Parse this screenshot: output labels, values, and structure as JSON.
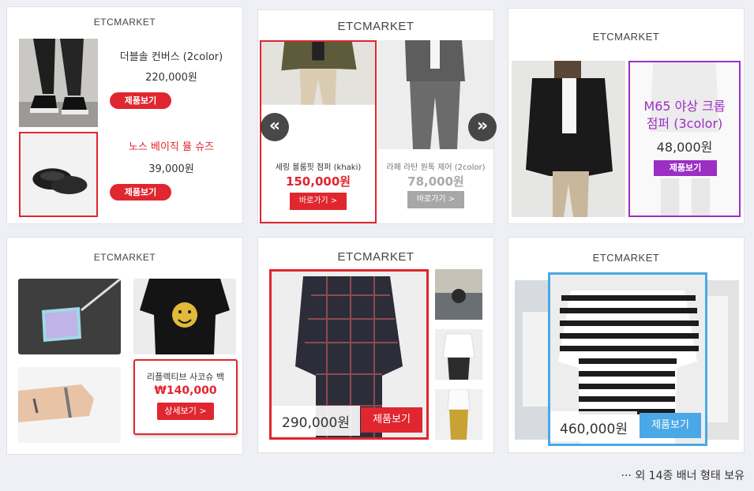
{
  "colors": {
    "red": "#e0262f",
    "purple": "#9b2fc3",
    "blue": "#4aa8e6",
    "gray": "#a7a7a7"
  },
  "b1": {
    "brand": "ETCMARKET",
    "item1": {
      "name": "더블솔 컨버스 (2color)",
      "price": "220,000원",
      "button": "제품보기"
    },
    "item2": {
      "name": "노스 베이직 뮬 슈즈",
      "price": "39,000원",
      "button": "제품보기"
    }
  },
  "b2": {
    "brand": "ETCMARKET",
    "prev_icon": "«",
    "next_icon": "»",
    "item1": {
      "name": "세링 볼룸핏 점퍼 (khaki)",
      "price": "150,000원",
      "button": "바로가기 >"
    },
    "item2": {
      "name": "라페 라탄 원톡 제어 (2color)",
      "price": "78,000원",
      "button": "바로가기 >"
    }
  },
  "b3": {
    "brand": "ETCMARKET",
    "item": {
      "name_line1": "M65 야상 크롭",
      "name_line2": "점퍼 (3color)",
      "price": "48,000원",
      "button": "제품보기"
    }
  },
  "b4": {
    "brand": "ETCMARKET",
    "item": {
      "name": "리플렉티브 사코슈 백",
      "price": "₩140,000",
      "button": "상세보기 >"
    }
  },
  "b5": {
    "brand": "ETCMARKET",
    "item": {
      "price": "290,000원",
      "button": "제품보기"
    }
  },
  "b6": {
    "brand": "ETCMARKET",
    "item": {
      "price": "460,000원",
      "button": "제품보기"
    }
  },
  "footer": "··· 외 14종 배너 형태 보유"
}
